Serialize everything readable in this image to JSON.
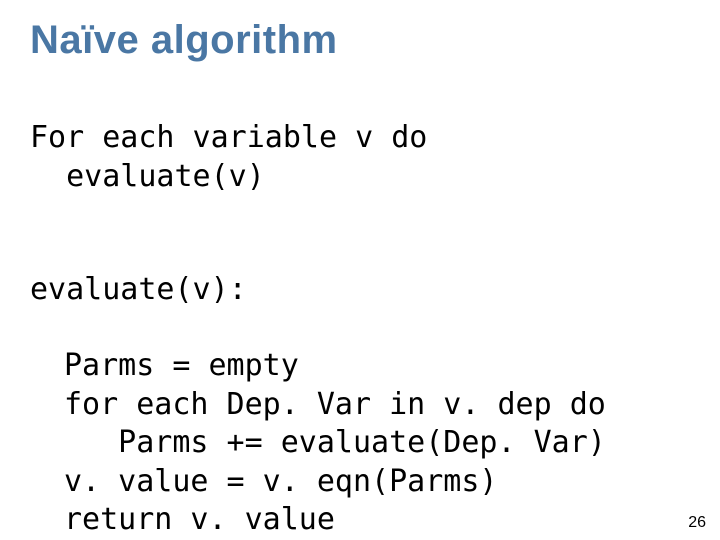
{
  "title": "Naïve algorithm",
  "block1_l1": "For each variable v do",
  "block1_l2": "  evaluate(v)",
  "block2_head": "evaluate(v):",
  "block2_l1": "Parms = empty",
  "block2_l2": "for each Dep. Var in v. dep do",
  "block2_l3": "   Parms += evaluate(Dep. Var)",
  "block2_l4": "v. value = v. eqn(Parms)",
  "block2_l5": "return v. value",
  "page_number": "26"
}
